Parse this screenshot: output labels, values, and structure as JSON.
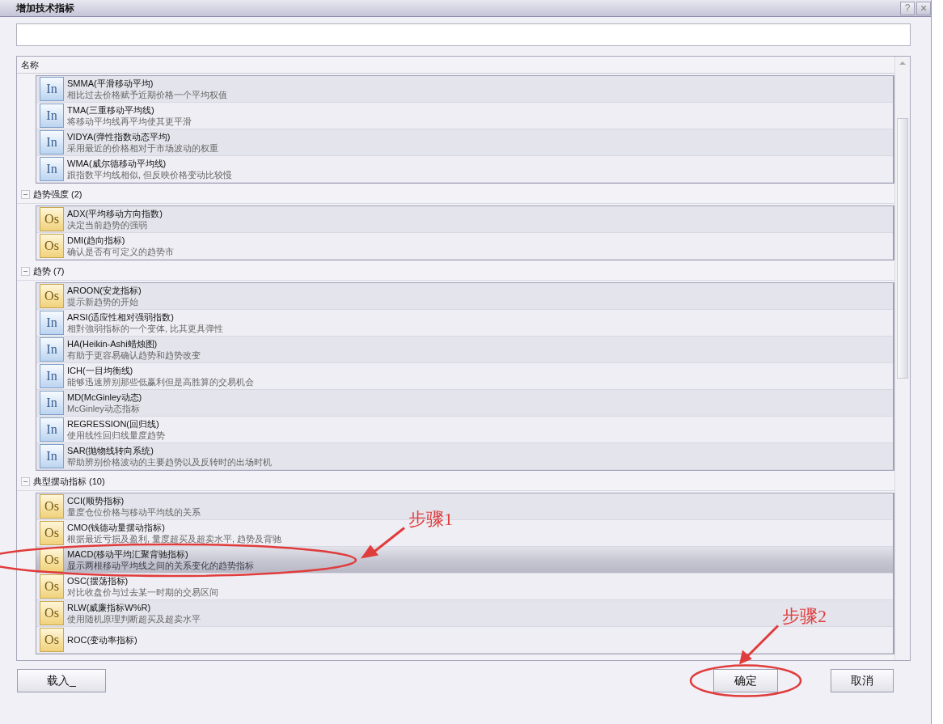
{
  "window": {
    "title": "增加技术指标",
    "controls": [
      {
        "kind": "help",
        "label": "?"
      },
      {
        "kind": "close",
        "label": "×"
      }
    ]
  },
  "list": {
    "column": "名称",
    "groups": [
      {
        "items": [
          {
            "kind": "overlay",
            "badge": "In",
            "name": "SMMA(平滑移动平均)",
            "description": "相比过去价格赋予近期价格一个平均权值",
            "selected": false
          },
          {
            "kind": "overlay",
            "badge": "In",
            "name": "TMA(三重移动平均线)",
            "description": "将移动平均线再平均使其更平滑",
            "selected": false
          },
          {
            "kind": "overlay",
            "badge": "In",
            "name": "VIDYA(弹性指数动态平均)",
            "description": "采用最近的价格相对于市场波动的权重",
            "selected": false
          },
          {
            "kind": "overlay",
            "badge": "In",
            "name": "WMA(威尔德移动平均线)",
            "description": "跟指数平均线相似, 但反映价格变动比较慢",
            "selected": false
          }
        ]
      },
      {
        "label": "趋势强度 (2)",
        "expanded": true,
        "items": [
          {
            "kind": "oscillator",
            "badge": "Os",
            "name": "ADX(平均移动方向指数)",
            "description": "决定当前趋势的强弱",
            "selected": false
          },
          {
            "kind": "oscillator",
            "badge": "Os",
            "name": "DMI(趋向指标)",
            "description": "确认是否有可定义的趋势市",
            "selected": false
          }
        ]
      },
      {
        "label": "趋势 (7)",
        "expanded": true,
        "items": [
          {
            "kind": "oscillator",
            "badge": "Os",
            "name": "AROON(安龙指标)",
            "description": "提示新趋势的开始",
            "selected": false
          },
          {
            "kind": "overlay",
            "badge": "In",
            "name": "ARSI(适应性相对强弱指数)",
            "description": "相對強弱指标的一个变体, 比其更具弹性",
            "selected": false
          },
          {
            "kind": "overlay",
            "badge": "In",
            "name": "HA(Heikin-Ashi蜡烛图)",
            "description": "有助于更容易确认趋势和趋势改变",
            "selected": false
          },
          {
            "kind": "overlay",
            "badge": "In",
            "name": "ICH(一目均衡线)",
            "description": "能够迅速辨别那些低赢利但是高胜算的交易机会",
            "selected": false
          },
          {
            "kind": "overlay",
            "badge": "In",
            "name": "MD(McGinley动态)",
            "description": "McGinley动态指标",
            "selected": false
          },
          {
            "kind": "overlay",
            "badge": "In",
            "name": "REGRESSION(回归线)",
            "description": "使用线性回归线量度趋势",
            "selected": false
          },
          {
            "kind": "overlay",
            "badge": "In",
            "name": "SAR(抛物线转向系统)",
            "description": "帮助辨别价格波动的主要趋势以及反转时的出场时机",
            "selected": false
          }
        ]
      },
      {
        "label": "典型摆动指标 (10)",
        "expanded": true,
        "items": [
          {
            "kind": "oscillator",
            "badge": "Os",
            "name": "CCI(顺势指标)",
            "description": "量度仓位价格与移动平均线的关系",
            "selected": false
          },
          {
            "kind": "oscillator",
            "badge": "Os",
            "name": "CMO(钱德动量摆动指标)",
            "description": "根据最近亏损及盈利, 量度超买及超卖水平, 趋势及背驰",
            "selected": false
          },
          {
            "kind": "oscillator",
            "badge": "Os",
            "name": "MACD(移动平均汇聚背驰指标)",
            "description": "显示两根移动平均线之间的关系变化的趋势指标",
            "selected": true
          },
          {
            "kind": "oscillator",
            "badge": "Os",
            "name": "OSC(摆荡指标)",
            "description": "对比收盘价与过去某一时期的交易区间",
            "selected": false
          },
          {
            "kind": "oscillator",
            "badge": "Os",
            "name": "RLW(威廉指标W%R)",
            "description": "使用随机原理判断超买及超卖水平",
            "selected": false
          },
          {
            "kind": "oscillator",
            "badge": "Os",
            "name": "ROC(变动率指标)",
            "selected": false
          }
        ]
      }
    ]
  },
  "buttons": [
    {
      "label": "载入_"
    },
    {
      "label": "确定"
    },
    {
      "label": "取消"
    }
  ],
  "annotations": [
    {
      "text": "步骤1"
    },
    {
      "text": "步骤2"
    }
  ]
}
